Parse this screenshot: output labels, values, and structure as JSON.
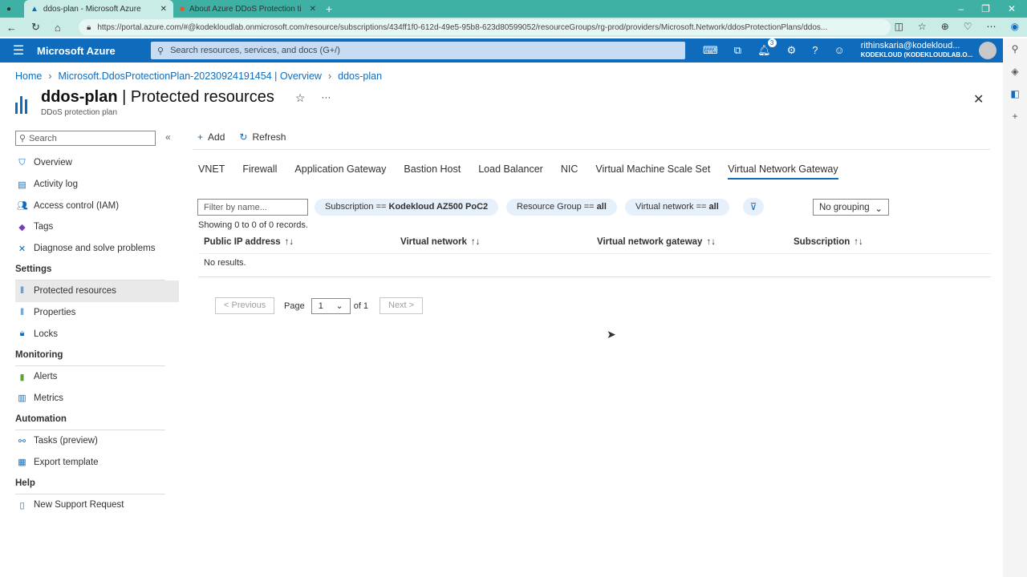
{
  "browser": {
    "tabs": [
      {
        "title": "ddos-plan - Microsoft Azure"
      },
      {
        "title": "About Azure DDoS Protection ti"
      }
    ],
    "url": "https://portal.azure.com/#@kodekloudlab.onmicrosoft.com/resource/subscriptions/434ff1f0-612d-49e5-95b8-623d80599052/resourceGroups/rg-prod/providers/Microsoft.Network/ddosProtectionPlans/ddos..."
  },
  "portal": {
    "brand": "Microsoft Azure",
    "search_placeholder": "Search resources, services, and docs (G+/)",
    "notifications": "3",
    "user_name": "rithinskaria@kodekloud...",
    "user_org": "KODEKLOUD (KODEKLOUDLAB.O..."
  },
  "breadcrumb": [
    "Home",
    "Microsoft.DdosProtectionPlan-20230924191454 | Overview",
    "ddos-plan"
  ],
  "header": {
    "resource": "ddos-plan",
    "page": " | Protected resources",
    "subtitle": "DDoS protection plan"
  },
  "sidebar": {
    "search_placeholder": "Search",
    "items": [
      {
        "label": "Overview",
        "icon": "shield-icon"
      },
      {
        "label": "Activity log",
        "icon": "log-icon"
      },
      {
        "label": "Access control (IAM)",
        "icon": "people-icon"
      },
      {
        "label": "Tags",
        "icon": "tag-icon"
      },
      {
        "label": "Diagnose and solve problems",
        "icon": "wrench-icon"
      }
    ],
    "sections": [
      {
        "title": "Settings",
        "items": [
          {
            "label": "Protected resources"
          },
          {
            "label": "Properties"
          },
          {
            "label": "Locks"
          }
        ]
      },
      {
        "title": "Monitoring",
        "items": [
          {
            "label": "Alerts"
          },
          {
            "label": "Metrics"
          }
        ]
      },
      {
        "title": "Automation",
        "items": [
          {
            "label": "Tasks (preview)"
          },
          {
            "label": "Export template"
          }
        ]
      },
      {
        "title": "Help",
        "items": [
          {
            "label": "New Support Request"
          }
        ]
      }
    ]
  },
  "toolbar": {
    "add": "Add",
    "refresh": "Refresh"
  },
  "tabs": [
    "VNET",
    "Firewall",
    "Application Gateway",
    "Bastion Host",
    "Load Balancer",
    "NIC",
    "Virtual Machine Scale Set",
    "Virtual Network Gateway"
  ],
  "filters": {
    "placeholder": "Filter by name...",
    "subscription_label": "Subscription == ",
    "subscription_value": "Kodekloud AZ500 PoC2",
    "rg_label": "Resource Group == ",
    "rg_value": "all",
    "vnet_label": "Virtual network == ",
    "vnet_value": "all",
    "grouping": "No grouping"
  },
  "table": {
    "showing": "Showing 0 to 0 of 0 records.",
    "columns": [
      "Public IP address",
      "Virtual network",
      "Virtual network gateway",
      "Subscription"
    ],
    "empty": "No results."
  },
  "pagination": {
    "previous": "< Previous",
    "page_label": "Page",
    "page": "1",
    "of": "of 1",
    "next": "Next >"
  }
}
